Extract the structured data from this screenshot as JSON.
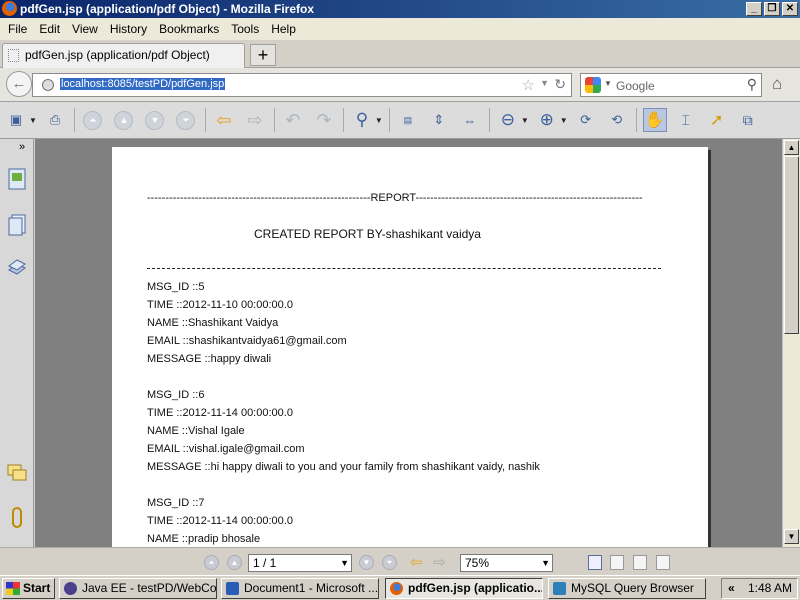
{
  "window": {
    "title": "pdfGen.jsp (application/pdf Object) - Mozilla Firefox"
  },
  "menu": [
    "File",
    "Edit",
    "View",
    "History",
    "Bookmarks",
    "Tools",
    "Help"
  ],
  "tab": {
    "label": "pdfGen.jsp (application/pdf Object)",
    "new_tab": "+"
  },
  "nav": {
    "url": "localhost:8085/testPD/pdfGen.jsp",
    "search_placeholder": "Google"
  },
  "document": {
    "header": "-------------------------------------------------------------REPORT--------------------------------------------------------------",
    "created_by": "CREATED REPORT BY-shashikant vaidya",
    "records": [
      {
        "msg_id": "MSG_ID ::5",
        "time": "TIME ::2012-11-10 00:00:00.0",
        "name": "NAME ::Shashikant Vaidya",
        "email": "EMAIL ::shashikantvaidya61@gmail.com",
        "message": "MESSAGE ::happy diwali"
      },
      {
        "msg_id": "MSG_ID ::6",
        "time": "TIME ::2012-11-14 00:00:00.0",
        "name": "NAME ::Vishal Igale",
        "email": "EMAIL ::vishal.igale@gmail.com",
        "message": "MESSAGE ::hi happy diwali to you and your family from shashikant vaidy, nashik"
      },
      {
        "msg_id": "MSG_ID ::7",
        "time": "TIME ::2012-11-14 00:00:00.0",
        "name": "NAME ::pradip bhosale"
      }
    ]
  },
  "status": {
    "page": "1 / 1",
    "zoom": "75%"
  },
  "taskbar": {
    "start": "Start",
    "tasks": [
      "Java EE - testPD/WebCo...",
      "Document1 - Microsoft ...",
      "pdfGen.jsp (applicatio...",
      "MySQL Query Browser"
    ],
    "chevron": "«",
    "clock": "1:48 AM"
  }
}
